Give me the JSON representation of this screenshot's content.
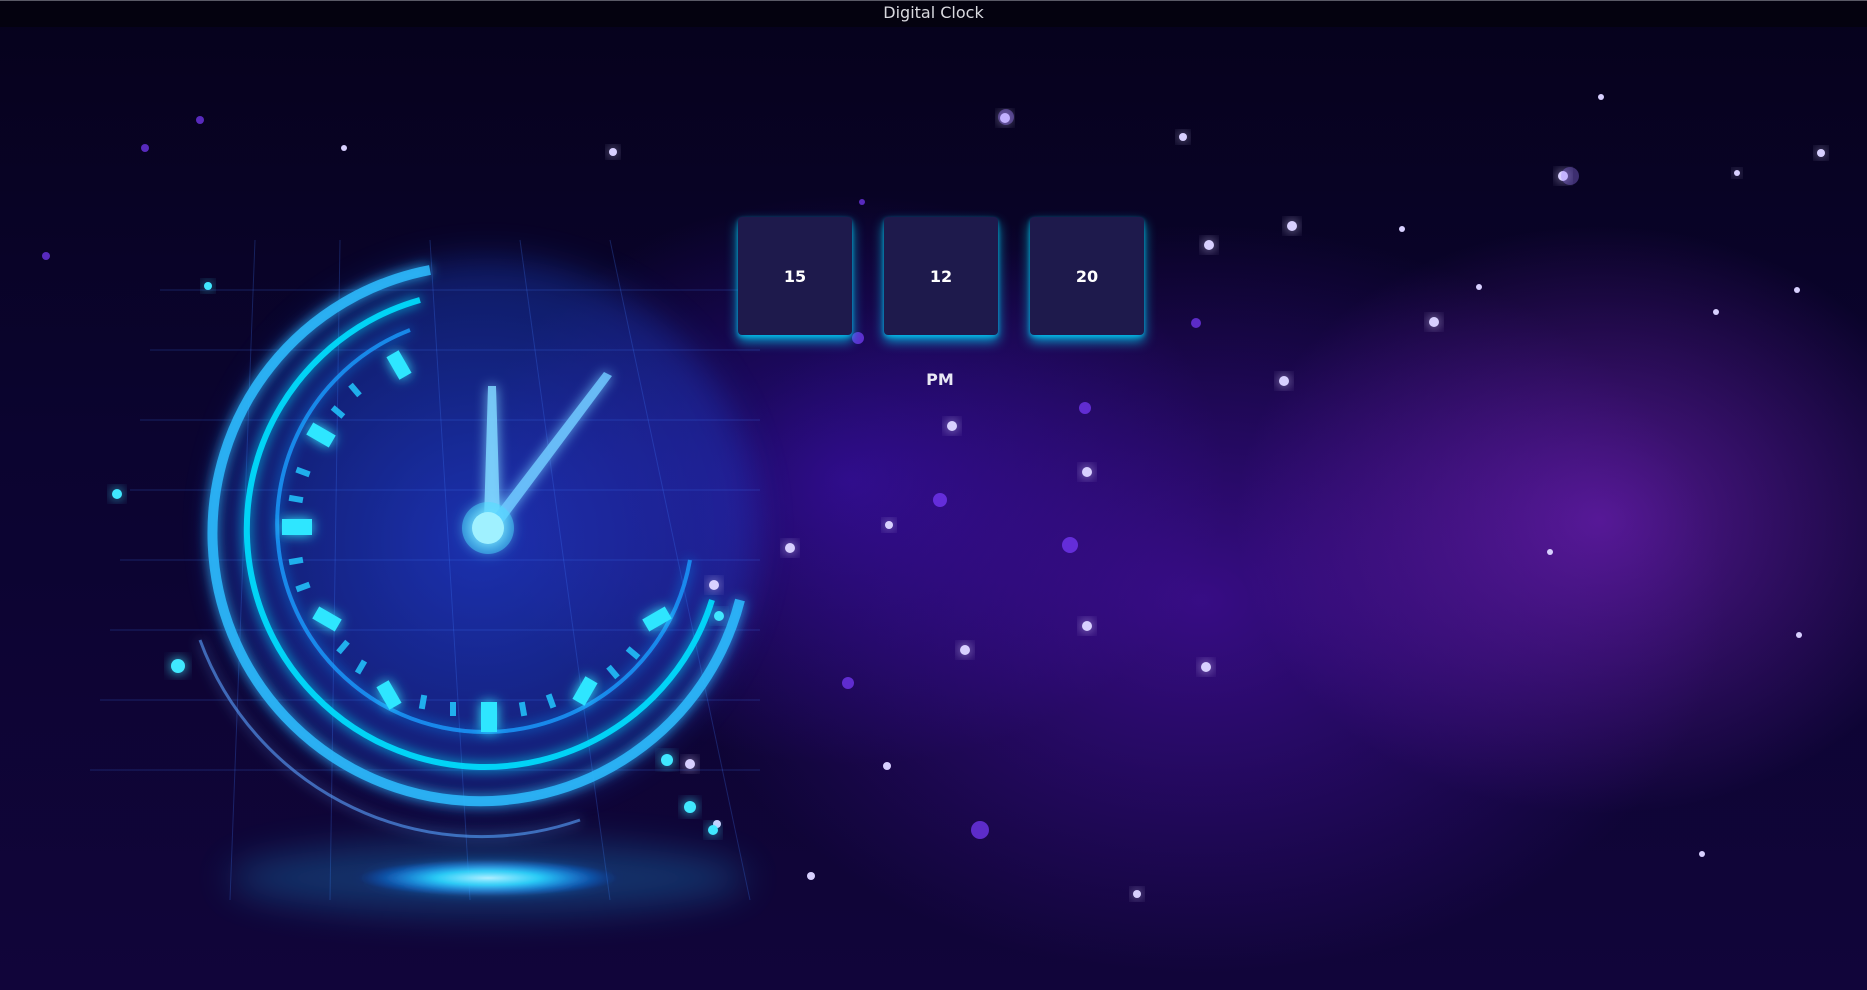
{
  "window": {
    "title": "Digital Clock"
  },
  "clock": {
    "hours": "15",
    "minutes": "12",
    "seconds": "20",
    "period": "PM"
  },
  "colors": {
    "accent_glow": "#00dcff",
    "digit_box_bg": "#1e1a4c",
    "background_deep": "#06021c",
    "background_purple": "#5a14c8"
  },
  "background": {
    "icon": "analog-clock-illustration"
  }
}
